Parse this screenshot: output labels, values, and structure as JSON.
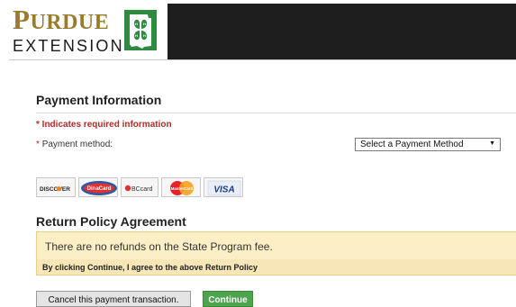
{
  "header": {
    "logo_purdue": "Purdue",
    "logo_extension": "EXTENSION",
    "clover_icon": "4-h-clover-indiana-icon"
  },
  "payment_info": {
    "title": "Payment Information",
    "required_note": "* Indicates required information",
    "method_star": "*",
    "method_label": "Payment method:",
    "method_select_value": "Select a Payment Method"
  },
  "cards": [
    {
      "name": "Discover",
      "label": "DISCOVER"
    },
    {
      "name": "Diners Club",
      "label": "DinaCard"
    },
    {
      "name": "BC Card",
      "label": "BCcard"
    },
    {
      "name": "MasterCard",
      "label": "MasterCard"
    },
    {
      "name": "Visa",
      "label": "VISA"
    }
  ],
  "return_policy": {
    "title": "Return Policy Agreement",
    "refund_text": "There are no refunds on the State Program fee.",
    "agree_text": "By clicking Continue, I agree to the above Return Policy"
  },
  "buttons": {
    "cancel_label": "Cancel this payment transaction.",
    "continue_label": "Continue"
  },
  "colors": {
    "brand_gold": "#9a7a2b",
    "required_red": "#b22b2b",
    "notice_bg": "#fcefc6",
    "continue_green": "#4ca44c"
  }
}
